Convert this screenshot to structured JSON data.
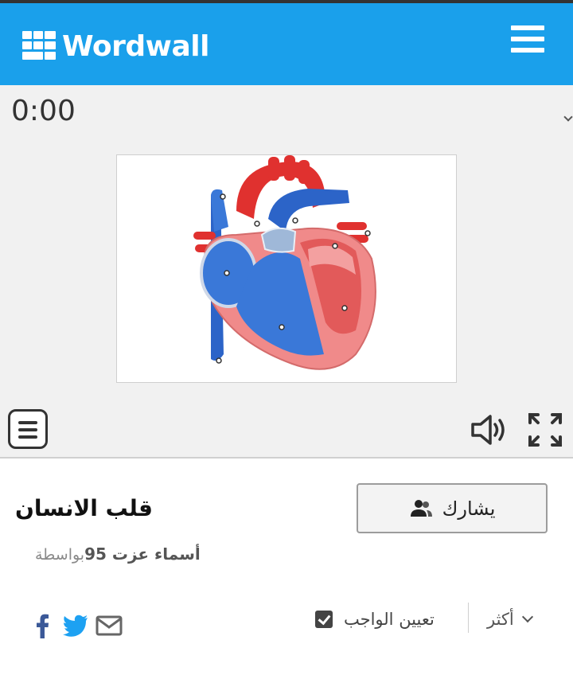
{
  "header": {
    "brand": "Wordwall",
    "brand_color": "#1aa0eb",
    "menu_icon": "hamburger-icon"
  },
  "game": {
    "timer": "0:00",
    "image_alt": "Human heart diagram with labeled points",
    "menu_icon": "list-menu-icon",
    "sound_icon": "speaker-icon",
    "fullscreen_icon": "fullscreen-icon"
  },
  "activity": {
    "title": "قلب الانسان",
    "by_label": "بواسطة",
    "author": "أسماء عزت 95"
  },
  "actions": {
    "share_label": "يشارك",
    "share_icon": "users-icon",
    "assign_label": "تعيين الواجب",
    "assign_icon": "checkbox-checked-icon",
    "more_label": "أكثر",
    "more_icon": "chevron-down-icon"
  },
  "social": {
    "facebook_color": "#3b5998",
    "twitter_color": "#1da1f2",
    "email_color": "#666666"
  }
}
